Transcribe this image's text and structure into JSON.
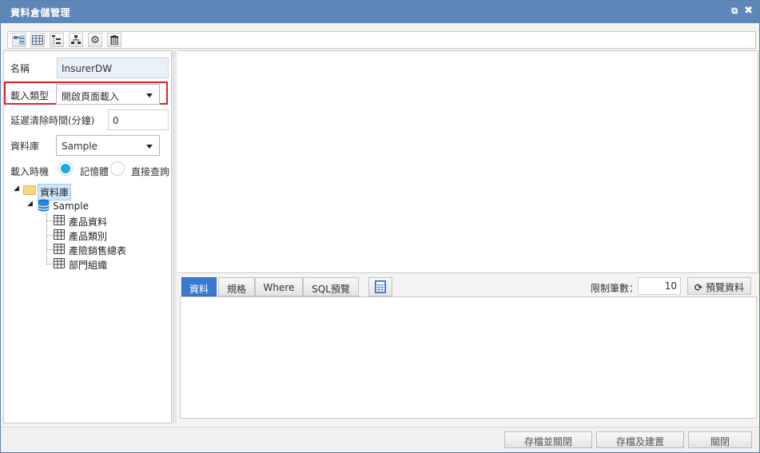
{
  "window": {
    "title": "資料倉儲管理"
  },
  "titlebar_buttons": {
    "restore": "⧉",
    "close": "✖"
  },
  "toolbar": {
    "buttons": [
      "field-map-icon",
      "table-icon",
      "tree-icon",
      "hierarchy-icon",
      "gear-icon",
      "trash-icon"
    ]
  },
  "form": {
    "name_label": "名稱",
    "name_value": "InsurerDW",
    "load_type_label": "載入類型",
    "load_type_value": "開啟頁面載入",
    "delay_label": "延遲清除時間(分鐘)",
    "delay_value": "0",
    "database_label": "資料庫",
    "database_value": "Sample",
    "load_timing_label": "載入時機",
    "radio_memory": "記憶體",
    "radio_direct": "直接查詢"
  },
  "tree": {
    "root": "資料庫",
    "db": "Sample",
    "tables": [
      "產品資料",
      "產品類別",
      "產險銷售總表",
      "部門組織"
    ]
  },
  "tabs": {
    "items": [
      "資料",
      "規格",
      "Where",
      "SQL預覽"
    ],
    "active": "資料",
    "limit_label": "限制筆數：",
    "limit_value": "10",
    "preview_button": "預覽資料"
  },
  "footer": {
    "save_close": "存檔並關閉",
    "save_build": "存檔及建置",
    "close": "關閉"
  },
  "colors": {
    "titlebar": "#5d87b8",
    "accent": "#3a7bd0",
    "highlight_box": "#e0202a",
    "radio_on": "#1aa9e8"
  }
}
